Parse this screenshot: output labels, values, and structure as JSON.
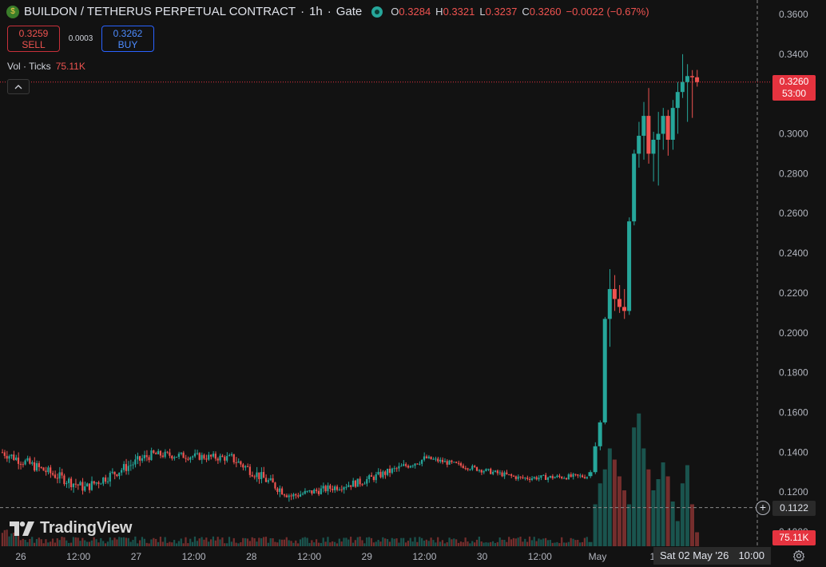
{
  "header": {
    "pair": "BUILDON / TETHERUS PERPETUAL CONTRACT",
    "sep1": "·",
    "interval": "1h",
    "sep2": "·",
    "exchange": "Gate",
    "ohlc": {
      "o_label": "O",
      "o": "0.3284",
      "h_label": "H",
      "h": "0.3321",
      "l_label": "L",
      "l": "0.3237",
      "c_label": "C",
      "c": "0.3260",
      "change": "−0.0022 (−0.67%)"
    }
  },
  "trade": {
    "sell_price": "0.3259",
    "sell_label": "SELL",
    "spread": "0.0003",
    "buy_price": "0.3262",
    "buy_label": "BUY"
  },
  "volume_legend": {
    "label": "Vol · Ticks",
    "value": "75.11K"
  },
  "tags": {
    "last_price": "0.3260",
    "countdown": "53:00",
    "crosshair_price": "0.1122",
    "volume": "75.11K",
    "crosshair_date": "Sat 02 May '26",
    "crosshair_time": "10:00"
  },
  "watermark": "TradingView",
  "icons": [
    "coin-logo-icon",
    "status-dot-icon",
    "chevron-up-icon",
    "plus-icon",
    "gear-icon",
    "tradingview-logo-icon"
  ],
  "colors": {
    "up": "#26a69a",
    "down": "#ef5350",
    "background": "#121212"
  },
  "chart_data": {
    "type": "candlestick",
    "price_axis_ticks": [
      "0.3600",
      "0.3400",
      "0.3200",
      "0.3000",
      "0.2800",
      "0.2600",
      "0.2400",
      "0.2200",
      "0.2000",
      "0.1800",
      "0.1600",
      "0.1400",
      "0.1200",
      "0.1000"
    ],
    "ylim": [
      0.098,
      0.366
    ],
    "x_axis_labels": [
      "26",
      "12:00",
      "27",
      "12:00",
      "28",
      "12:00",
      "29",
      "12:00",
      "30",
      "12:00",
      "May",
      "12"
    ],
    "series": [
      {
        "segments": [
          {
            "from": 0,
            "to": 36,
            "start": 0.14,
            "end": 0.122,
            "amp": 0.004
          },
          {
            "from": 36,
            "to": 65,
            "start": 0.122,
            "end": 0.139,
            "amp": 0.004
          },
          {
            "from": 65,
            "to": 100,
            "start": 0.139,
            "end": 0.137,
            "amp": 0.003
          },
          {
            "from": 100,
            "to": 126,
            "start": 0.137,
            "end": 0.118,
            "amp": 0.004
          },
          {
            "from": 126,
            "to": 156,
            "start": 0.118,
            "end": 0.125,
            "amp": 0.003
          },
          {
            "from": 156,
            "to": 185,
            "start": 0.125,
            "end": 0.137,
            "amp": 0.003
          },
          {
            "from": 185,
            "to": 226,
            "start": 0.137,
            "end": 0.127,
            "amp": 0.002
          },
          {
            "from": 226,
            "to": 256,
            "start": 0.127,
            "end": 0.128,
            "amp": 0.002
          }
        ],
        "total_candles": 256,
        "spike": [
          {
            "o": 0.128,
            "h": 0.131,
            "l": 0.127,
            "c": 0.13
          },
          {
            "o": 0.13,
            "h": 0.145,
            "l": 0.129,
            "c": 0.143
          },
          {
            "o": 0.143,
            "h": 0.156,
            "l": 0.141,
            "c": 0.155
          },
          {
            "o": 0.155,
            "h": 0.208,
            "l": 0.154,
            "c": 0.207
          },
          {
            "o": 0.207,
            "h": 0.232,
            "l": 0.193,
            "c": 0.222
          },
          {
            "o": 0.222,
            "h": 0.229,
            "l": 0.211,
            "c": 0.217
          },
          {
            "o": 0.217,
            "h": 0.224,
            "l": 0.21,
            "c": 0.213
          },
          {
            "o": 0.213,
            "h": 0.222,
            "l": 0.207,
            "c": 0.211
          },
          {
            "o": 0.211,
            "h": 0.258,
            "l": 0.209,
            "c": 0.256
          },
          {
            "o": 0.256,
            "h": 0.292,
            "l": 0.254,
            "c": 0.29
          },
          {
            "o": 0.29,
            "h": 0.306,
            "l": 0.283,
            "c": 0.299
          },
          {
            "o": 0.299,
            "h": 0.316,
            "l": 0.287,
            "c": 0.309
          },
          {
            "o": 0.309,
            "h": 0.323,
            "l": 0.285,
            "c": 0.29
          },
          {
            "o": 0.29,
            "h": 0.301,
            "l": 0.276,
            "c": 0.297
          },
          {
            "o": 0.297,
            "h": 0.311,
            "l": 0.274,
            "c": 0.3
          },
          {
            "o": 0.3,
            "h": 0.313,
            "l": 0.292,
            "c": 0.309
          },
          {
            "o": 0.309,
            "h": 0.312,
            "l": 0.289,
            "c": 0.297
          },
          {
            "o": 0.297,
            "h": 0.317,
            "l": 0.292,
            "c": 0.313
          },
          {
            "o": 0.313,
            "h": 0.326,
            "l": 0.3,
            "c": 0.321
          },
          {
            "o": 0.321,
            "h": 0.34,
            "l": 0.318,
            "c": 0.326
          },
          {
            "o": 0.326,
            "h": 0.335,
            "l": 0.306,
            "c": 0.329
          },
          {
            "o": 0.329,
            "h": 0.332,
            "l": 0.308,
            "c": 0.3284
          },
          {
            "o": 0.3284,
            "h": 0.3321,
            "l": 0.3237,
            "c": 0.326
          }
        ]
      }
    ],
    "volume_spike_rel": [
      0.03,
      0.3,
      0.45,
      0.55,
      0.7,
      0.62,
      0.5,
      0.4,
      0.3,
      0.85,
      0.95,
      0.7,
      0.55,
      0.4,
      0.48,
      0.6,
      0.5,
      0.32,
      0.18,
      0.45,
      0.58,
      0.3,
      0.1
    ]
  }
}
